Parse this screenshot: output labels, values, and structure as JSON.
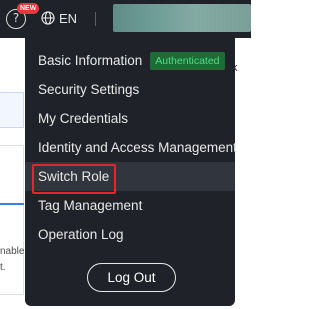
{
  "header": {
    "new_badge": "NEW",
    "language": "EN"
  },
  "background": {
    "text_lines": [
      "nable",
      "t."
    ]
  },
  "menu": {
    "items": [
      {
        "label": "Basic Information",
        "badge": "Authenticated"
      },
      {
        "label": "Security Settings"
      },
      {
        "label": "My Credentials"
      },
      {
        "label": "Identity and Access Management"
      },
      {
        "label": "Switch Role"
      },
      {
        "label": "Tag Management"
      },
      {
        "label": "Operation Log"
      }
    ],
    "logout_label": "Log Out"
  },
  "colors": {
    "menu_background": "#1f2329",
    "badge_background": "#1e6b35",
    "badge_text": "#4fdd83",
    "highlight": "#e5262c"
  }
}
